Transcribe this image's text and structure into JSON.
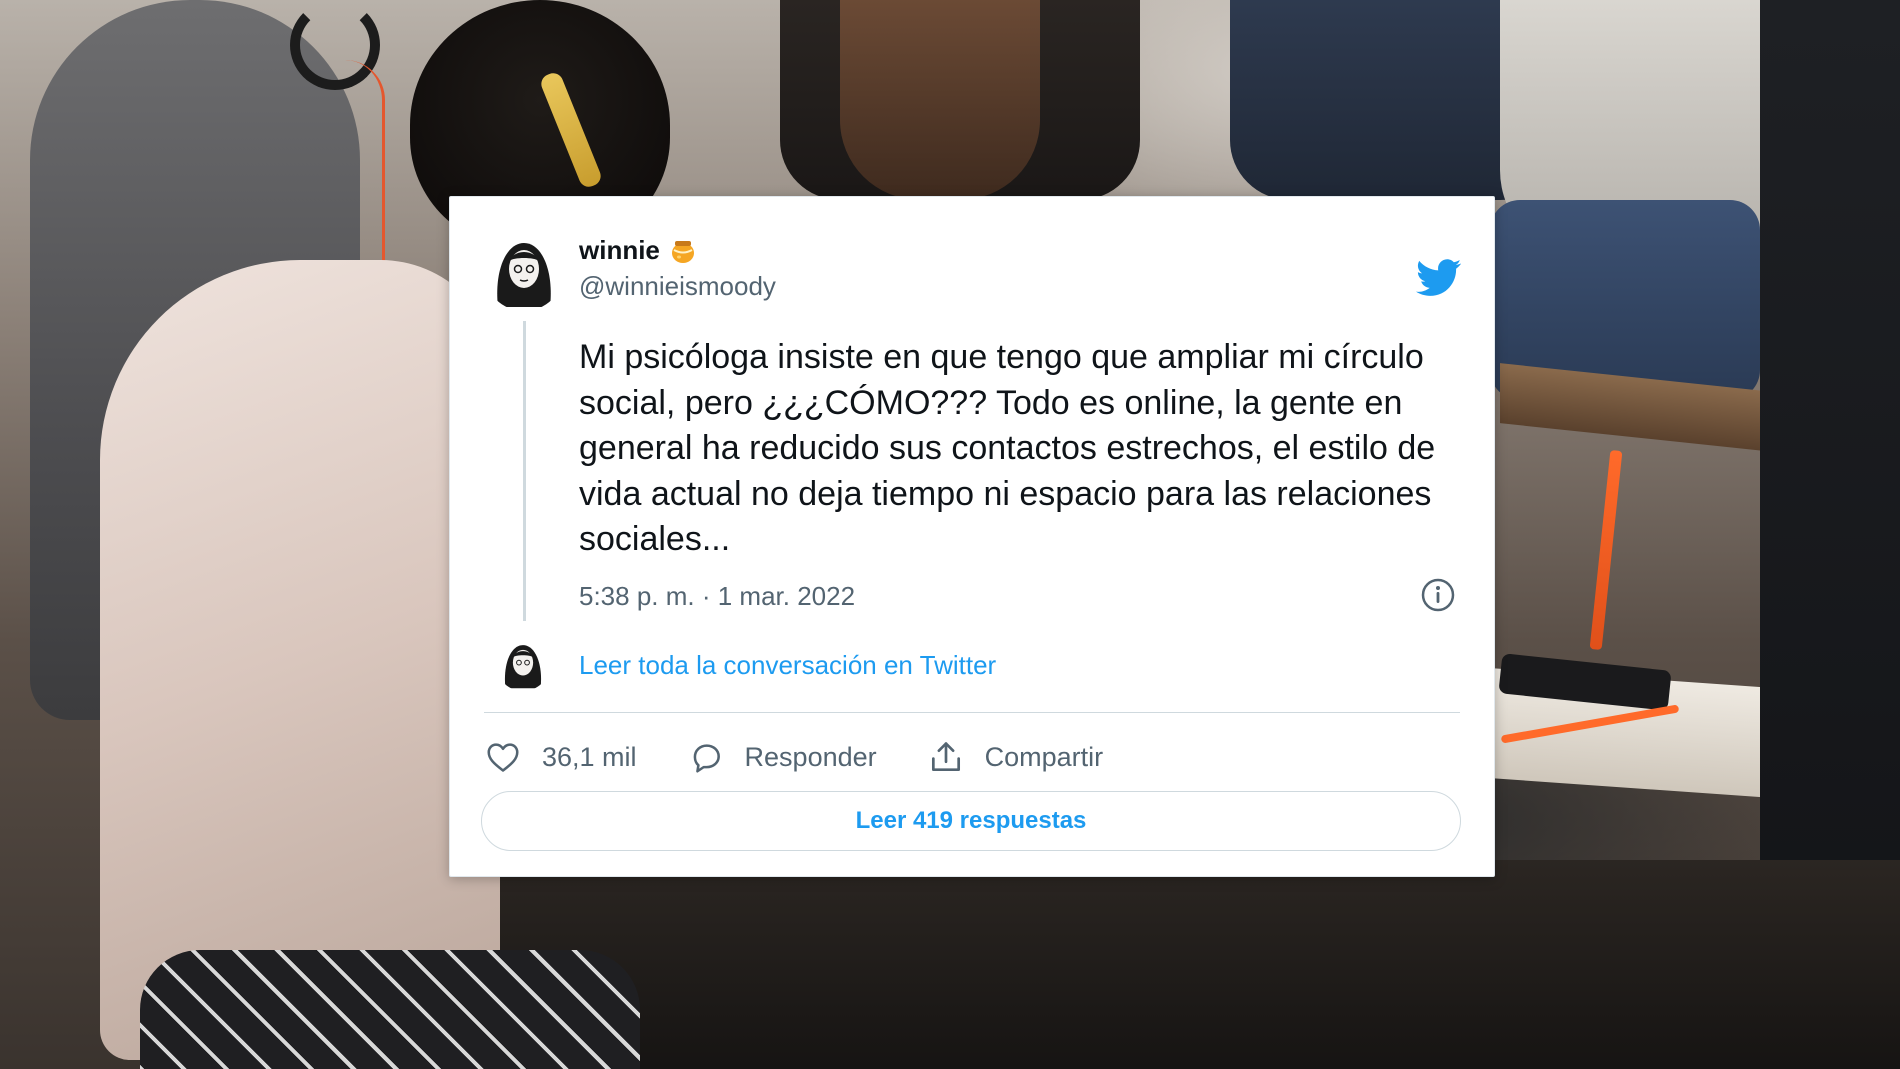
{
  "tweet": {
    "author": {
      "name": "winnie",
      "handle": "@winnieismoody",
      "name_emoji_icon": "honey-pot-icon"
    },
    "brand_icon": "twitter-bird-icon",
    "brand_color": "#1d9bf0",
    "text": "Mi psicóloga insiste en que tengo que ampliar mi círculo social, pero ¿¿¿CÓMO??? Todo es online, la gente en general ha reducido sus contactos estrechos, el estilo de vida actual no deja tiempo ni espacio para las relaciones sociales...",
    "timestamp": "5:38 p. m. · 1 mar. 2022",
    "conversation_link": "Leer toda la conversación en Twitter",
    "actions": {
      "like_count": "36,1 mil",
      "reply_label": "Responder",
      "share_label": "Compartir"
    },
    "read_replies_label": "Leer 419 respuestas"
  }
}
